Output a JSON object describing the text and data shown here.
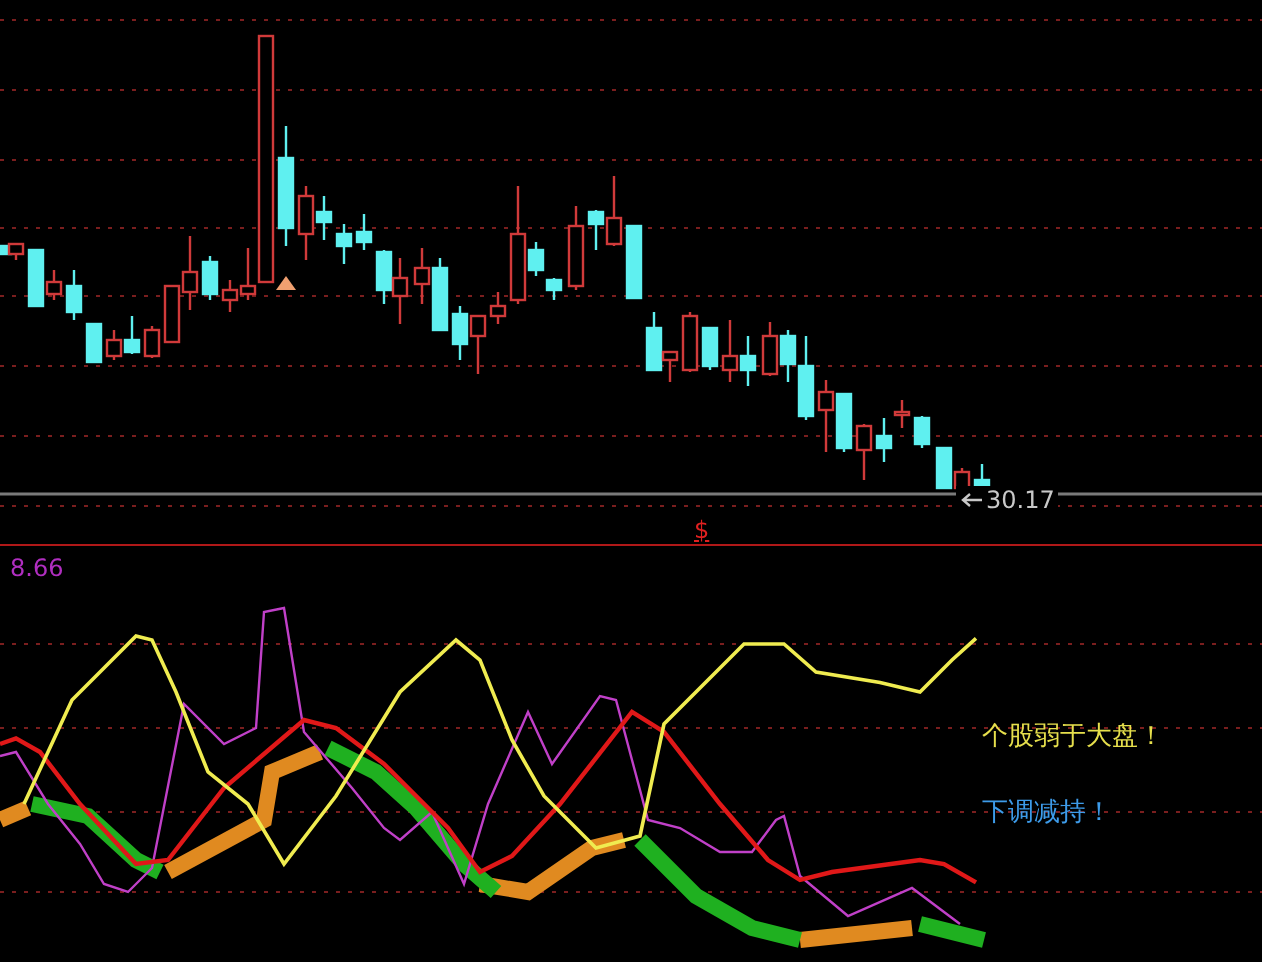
{
  "price_chart": {
    "last_price_label": "30.17"
  },
  "signal_marker": {
    "text": "$"
  },
  "indicator": {
    "value": "8.66",
    "annotations": [
      {
        "text": "个股弱于大盘！",
        "color": "#e6df4c"
      },
      {
        "text": "下调减持！",
        "color": "#3d9be9"
      }
    ]
  }
}
